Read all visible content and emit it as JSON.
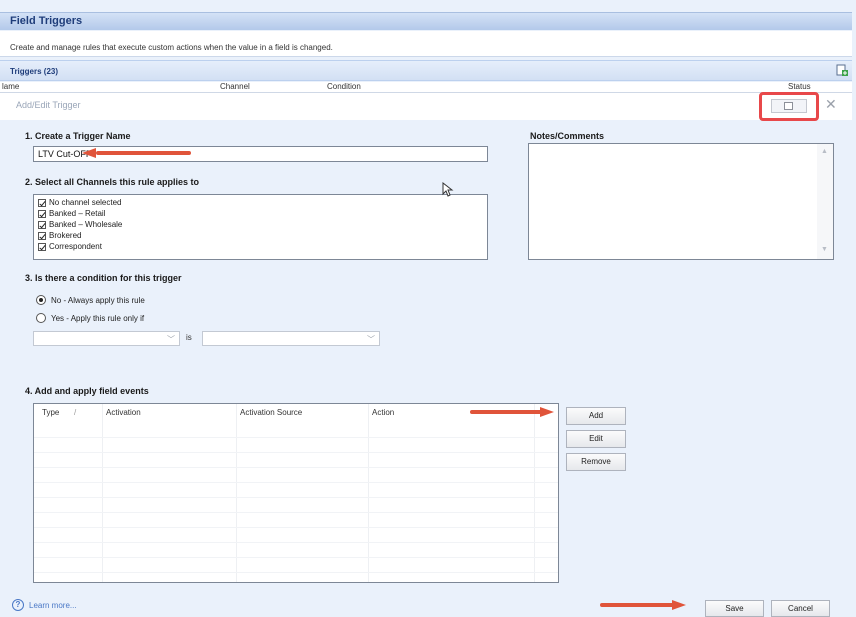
{
  "background_page": {
    "title": "Field Triggers",
    "description": "Create and manage rules that execute custom actions when the value in a field is changed.",
    "triggers_label": "Triggers (23)",
    "columns": [
      "lame",
      "Channel",
      "Condition",
      "Status"
    ]
  },
  "dialog": {
    "title": "Add/Edit Trigger",
    "section1": {
      "title": "1. Create a Trigger Name",
      "value": "LTV Cut-OFF"
    },
    "section2": {
      "title": "2. Select all Channels this rule applies to",
      "channels": [
        {
          "label": "No channel selected",
          "checked": true
        },
        {
          "label": "Banked – Retail",
          "checked": true
        },
        {
          "label": "Banked – Wholesale",
          "checked": true
        },
        {
          "label": "Brokered",
          "checked": true
        },
        {
          "label": "Correspondent",
          "checked": true
        }
      ]
    },
    "notes": {
      "title": "Notes/Comments",
      "value": ""
    },
    "section3": {
      "title": "3. Is there a condition for this trigger",
      "option_no": "No - Always apply this rule",
      "option_yes": "Yes - Apply this rule only if",
      "selected": "no",
      "is_label": "is"
    },
    "section4": {
      "title": "4. Add and apply field events",
      "columns": [
        "Type",
        "/",
        "Activation",
        "Activation Source",
        "Action"
      ],
      "rows": []
    },
    "buttons": {
      "add": "Add",
      "edit": "Edit",
      "remove": "Remove",
      "save": "Save",
      "cancel": "Cancel"
    },
    "learn_more": "Learn more..."
  },
  "colors": {
    "annotation_red": "#e0543a",
    "header_blue": "#1f3d7a",
    "link_blue": "#4a78c6"
  }
}
